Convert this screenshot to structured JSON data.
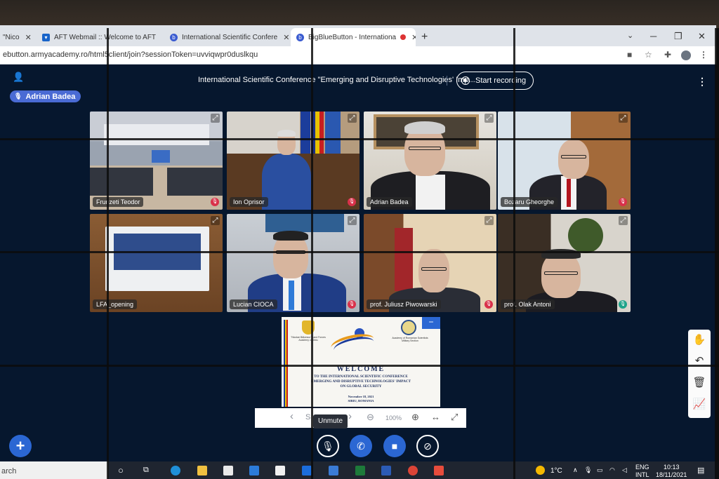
{
  "browser": {
    "tabs": [
      {
        "label": "\"Nico",
        "icon": "document-icon"
      },
      {
        "label": "AFT Webmail :: Welcome to AFT",
        "icon": "mail-icon"
      },
      {
        "label": "International Scientific Confere",
        "icon": "bigbluebutton-icon"
      },
      {
        "label": "BigBlueButton - Internationa",
        "icon": "bigbluebutton-icon",
        "active": true,
        "recording": true
      }
    ],
    "new_tab": "+",
    "url": "ebutton.armyacademy.ro/html5client/join?sessionToken=uvviqwpr0duslkqu",
    "window_controls": [
      "─",
      "❐",
      "✕"
    ]
  },
  "app": {
    "presenter_name": "Adrian Badea",
    "meeting_title": "International Scientific Conference \"Emerging and Disruptive Technologies' Imp...",
    "record_label": "Start recording",
    "participants": [
      {
        "name": "Frunzeti Teodor",
        "muted": true
      },
      {
        "name": "Ion Oprisor",
        "muted": true
      },
      {
        "name": "Adrian Badea",
        "muted": false,
        "mic": "none"
      },
      {
        "name": "Bozaru Gheorghe",
        "muted": true
      },
      {
        "name": "LFA_opening",
        "muted": false,
        "mic": "none"
      },
      {
        "name": "Lucian CIOCA",
        "muted": true
      },
      {
        "name": "prof. Juliusz Piwowarski",
        "muted": true
      },
      {
        "name": "prof. Olak Antoni",
        "muted": false,
        "mic": "on"
      }
    ],
    "slide": {
      "left_caption": "\"Nicolae Bălcescu\" Land Forces Academy of Sibiu",
      "right_caption": "Academy of Romanian Scientists Military Section",
      "welcome": "WELCOME",
      "line1": "TO THE INTERNATIONAL SCIENTIFIC CONFERENCE",
      "line2": "EMERGING AND DISRUPTIVE TECHNOLOGIES' IMPACT",
      "line3": "ON GLOBAL SECURITY",
      "date": "November 18, 2021",
      "place": "SIBIU, ROMANIA",
      "minimize": "−"
    },
    "slide_toolbar": {
      "prev": "‹",
      "slide_label": "S",
      "next": "›",
      "zoom_out": "⊖",
      "zoom": "100%",
      "zoom_in": "⊕",
      "fit_width": "↔",
      "fullscreen": "⤢"
    },
    "tooltip": "Unmute",
    "actions": [
      "unmute",
      "leave-audio",
      "share-webcam",
      "share-screen"
    ],
    "plus": "+",
    "whiteboard_tools": [
      "✋",
      "↶",
      "🗑",
      "📈"
    ]
  },
  "taskbar": {
    "search": "arch",
    "weather": "1°C",
    "lang_top": "ENG",
    "lang_bottom": "INTL",
    "time": "10:13",
    "date": "18/11/2021"
  }
}
